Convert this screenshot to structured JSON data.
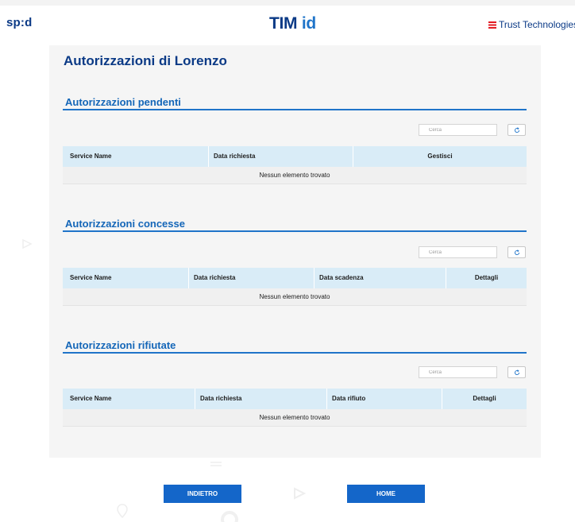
{
  "header": {
    "spid_logo": "sp:d",
    "timid_logo_main": "TIM",
    "timid_logo_accent": "id",
    "trust_logo": "Trust Technologies"
  },
  "page": {
    "title": "Autorizzazioni di Lorenzo"
  },
  "sections": [
    {
      "title": "Autorizzazioni pendenti",
      "search_placeholder": "Cerca",
      "columns": [
        "Service Name",
        "Data richiesta",
        "Gestisci"
      ],
      "empty_message": "Nessun elemento trovato"
    },
    {
      "title": "Autorizzazioni concesse",
      "search_placeholder": "Cerca",
      "columns": [
        "Service Name",
        "Data richiesta",
        "Data scadenza",
        "Dettagli"
      ],
      "empty_message": "Nessun elemento trovato"
    },
    {
      "title": "Autorizzazioni rifiutate",
      "search_placeholder": "Cerca",
      "columns": [
        "Service Name",
        "Data richiesta",
        "Data rifiuto",
        "Dettagli"
      ],
      "empty_message": "Nessun elemento trovato"
    }
  ],
  "footer": {
    "back_label": "INDIETRO",
    "home_label": "HOME"
  },
  "icons": {
    "refresh": "refresh-icon"
  },
  "colors": {
    "brand_dark": "#0b3a86",
    "brand_accent": "#1f74c9",
    "button": "#1466c9",
    "table_header": "#d9ecf7",
    "trust_red": "#e31b23"
  }
}
